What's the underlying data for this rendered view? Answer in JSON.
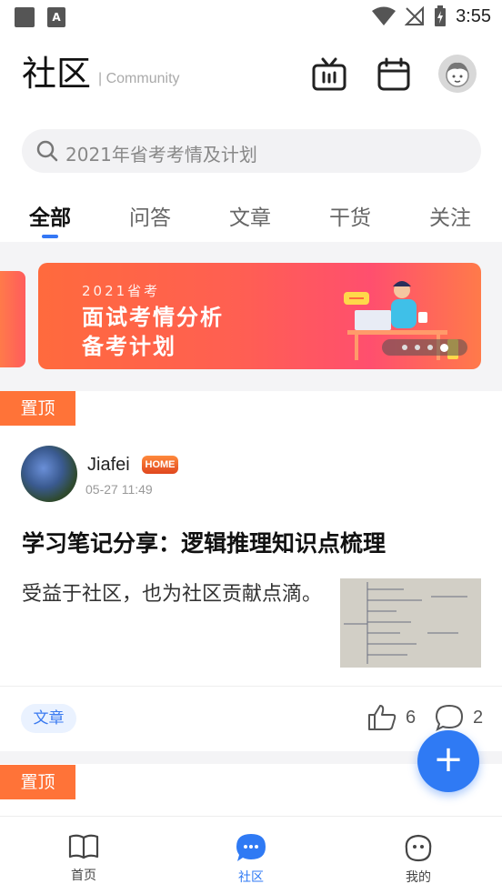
{
  "status_bar": {
    "time": "3:55"
  },
  "header": {
    "title": "社区",
    "subtitle": "| Community"
  },
  "search": {
    "placeholder": "2021年省考考情及计划"
  },
  "tabs": [
    {
      "label": "全部",
      "active": true
    },
    {
      "label": "问答"
    },
    {
      "label": "文章"
    },
    {
      "label": "干货"
    },
    {
      "label": "关注"
    }
  ],
  "banner": {
    "small_text": "2021省考",
    "line1": "面试考情分析",
    "line2": "备考计划",
    "pages": 4,
    "active_page": 4
  },
  "pin_label": "置顶",
  "post": {
    "username": "Jiafei",
    "badge": "HOME",
    "time": "05-27 11:49",
    "title": "学习笔记分享：逻辑推理知识点梳理",
    "body": "受益于社区，也为社区贡献点滴。",
    "tag": "文章",
    "likes": "6",
    "comments": "2"
  },
  "fab": {
    "label": "+"
  },
  "bottom_nav": [
    {
      "label": "首页",
      "icon": "book-icon"
    },
    {
      "label": "社区",
      "icon": "chat-icon",
      "active": true
    },
    {
      "label": "我的",
      "icon": "face-icon"
    }
  ],
  "colors": {
    "accent": "#2f7af4",
    "pin": "#ff7338",
    "banner": "#ff5f52"
  }
}
